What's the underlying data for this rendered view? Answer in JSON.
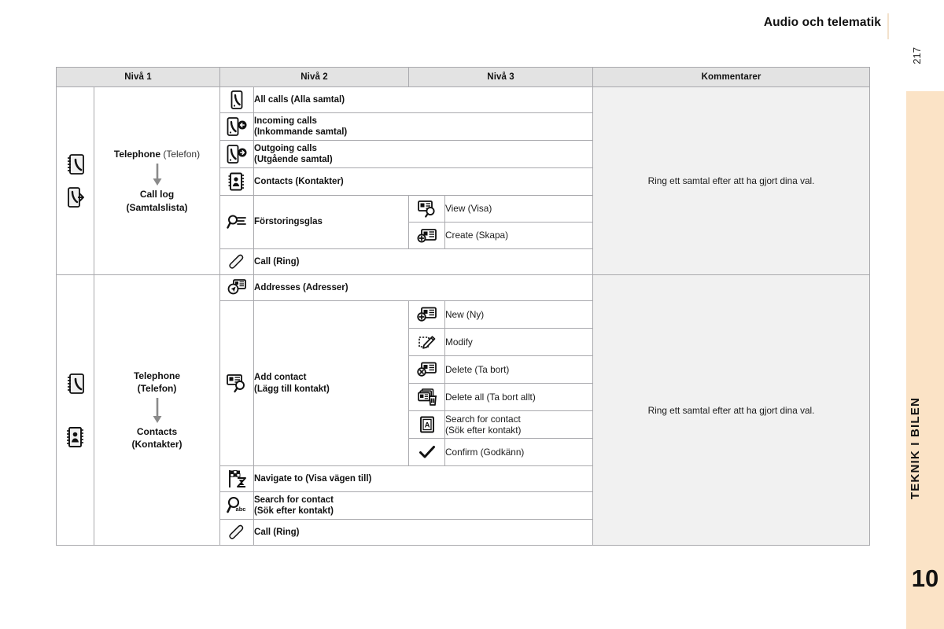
{
  "header": {
    "title": "Audio och telematik",
    "page_number": "217"
  },
  "side_tab": {
    "chapter_title": "TEKNIK I BILEN",
    "chapter_number": "10"
  },
  "table": {
    "columns": [
      "Nivå 1",
      "Nivå 2",
      "Nivå 3",
      "Kommentarer"
    ],
    "sections": [
      {
        "level1": {
          "icons": [
            "phonebook-icon",
            "call-log-icon"
          ],
          "top_label": "Telephone",
          "top_label_note": "(Telefon)",
          "arrow": "down-arrow-icon",
          "bottom_label": "Call log",
          "bottom_label_note": "(Samtalslista)"
        },
        "comment": "Ring ett samtal efter att ha gjort dina val.",
        "rows": [
          {
            "icon": "all-calls-icon",
            "label": "All calls (Alla samtal)",
            "level3": []
          },
          {
            "icon": "incoming-calls-icon",
            "label_line1": "Incoming calls",
            "label_line2": "(Inkommande samtal)",
            "level3": []
          },
          {
            "icon": "outgoing-calls-icon",
            "label_line1": "Outgoing calls",
            "label_line2": "(Utgående samtal)",
            "level3": []
          },
          {
            "icon": "contacts-icon",
            "label": "Contacts (Kontakter)",
            "level3": []
          },
          {
            "icon": "magnifier-list-icon",
            "label": "Förstoringsglas",
            "level3": [
              {
                "icon": "view-card-icon",
                "label": "View (Visa)"
              },
              {
                "icon": "create-card-icon",
                "label": "Create (Skapa)"
              }
            ]
          },
          {
            "icon": "handset-icon",
            "label": "Call (Ring)",
            "level3": []
          }
        ]
      },
      {
        "level1": {
          "icons": [
            "phonebook-icon",
            "contacts-icon"
          ],
          "top_label": "Telephone",
          "top_label_note": "(Telefon)",
          "arrow": "down-arrow-icon",
          "bottom_label": "Contacts",
          "bottom_label_note": "(Kontakter)"
        },
        "comment": "Ring ett samtal efter att ha gjort dina val.",
        "rows": [
          {
            "icon": "addresses-icon",
            "label": "Addresses (Adresser)",
            "level3": []
          },
          {
            "icon": "add-contact-icon",
            "label_line1": "Add contact",
            "label_line2": "(Lägg till kontakt)",
            "level3": [
              {
                "icon": "new-card-icon",
                "label": "New (Ny)"
              },
              {
                "icon": "modify-pencil-icon",
                "label": "Modify"
              },
              {
                "icon": "delete-card-icon",
                "label": "Delete (Ta bort)"
              },
              {
                "icon": "delete-all-icon",
                "label": "Delete all (Ta bort allt)"
              },
              {
                "icon": "search-letter-icon",
                "label_line1": "Search for contact",
                "label_line2": "(Sök efter kontakt)"
              },
              {
                "icon": "check-icon",
                "label": "Confirm (Godkänn)"
              }
            ]
          },
          {
            "icon": "navigate-flag-icon",
            "label": "Navigate to (Visa vägen till)",
            "level3": []
          },
          {
            "icon": "search-abc-icon",
            "label_line1": "Search for contact",
            "label_line2": "(Sök efter kontakt)",
            "level3": []
          },
          {
            "icon": "handset-icon",
            "label": "Call (Ring)",
            "level3": []
          }
        ]
      }
    ]
  },
  "colors": {
    "side_tab": "#fbe3c6",
    "table_header": "#e3e3e3",
    "comment_bg": "#f1f1f1",
    "border": "#a9a9ad"
  }
}
